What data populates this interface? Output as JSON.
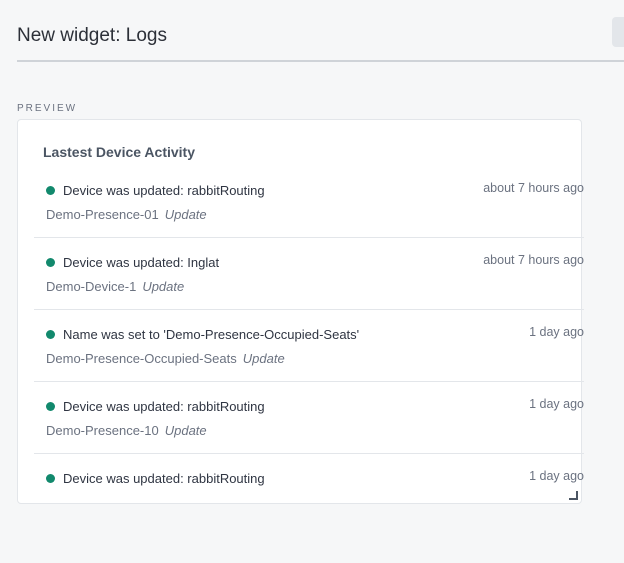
{
  "header": {
    "title": "New widget: Logs"
  },
  "preview": {
    "label": "PREVIEW"
  },
  "widget": {
    "title": "Lastest Device Activity",
    "status_color": "#12896d",
    "logs": [
      {
        "message": "Device was updated: rabbitRouting",
        "time": "about 7 hours ago",
        "device": "Demo-Presence-01",
        "action": "Update"
      },
      {
        "message": "Device was updated: Inglat",
        "time": "about 7 hours ago",
        "device": "Demo-Device-1",
        "action": "Update"
      },
      {
        "message": "Name was set to 'Demo-Presence-Occupied-Seats'",
        "time": "1 day ago",
        "device": "Demo-Presence-Occupied-Seats",
        "action": "Update"
      },
      {
        "message": "Device was updated: rabbitRouting",
        "time": "1 day ago",
        "device": "Demo-Presence-10",
        "action": "Update"
      },
      {
        "message": "Device was updated: rabbitRouting",
        "time": "1 day ago",
        "device": "",
        "action": ""
      }
    ]
  }
}
